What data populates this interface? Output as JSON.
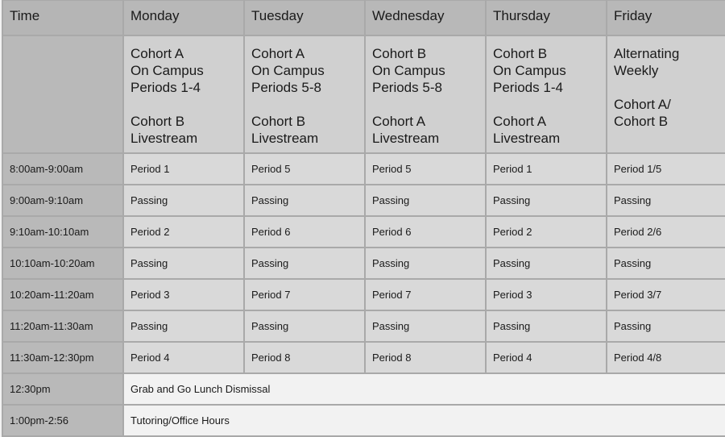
{
  "header": {
    "time_label": "Time",
    "days": [
      "Monday",
      "Tuesday",
      "Wednesday",
      "Thursday",
      "Friday"
    ]
  },
  "cohorts": [
    {
      "lines": [
        "Cohort A",
        "On Campus",
        "Periods 1-4"
      ],
      "lines2": [
        "Cohort B",
        "Livestream"
      ]
    },
    {
      "lines": [
        "Cohort A",
        "On Campus",
        "Periods 5-8"
      ],
      "lines2": [
        "Cohort B",
        "Livestream"
      ]
    },
    {
      "lines": [
        "Cohort B",
        "On Campus",
        "Periods 5-8"
      ],
      "lines2": [
        "Cohort A",
        "Livestream"
      ]
    },
    {
      "lines": [
        "Cohort B",
        "On Campus",
        "Periods 1-4"
      ],
      "lines2": [
        "Cohort A",
        "Livestream"
      ]
    },
    {
      "lines": [
        "Alternating",
        "Weekly"
      ],
      "lines2": [
        "Cohort A/",
        "Cohort B"
      ]
    }
  ],
  "rows": [
    {
      "time": "8:00am-9:00am",
      "cells": [
        "Period 1",
        "Period 5",
        "Period 5",
        "Period 1",
        "Period 1/5"
      ]
    },
    {
      "time": "9:00am-9:10am",
      "cells": [
        "Passing",
        "Passing",
        "Passing",
        "Passing",
        "Passing"
      ]
    },
    {
      "time": "9:10am-10:10am",
      "cells": [
        "Period 2",
        "Period 6",
        "Period 6",
        "Period 2",
        "Period 2/6"
      ]
    },
    {
      "time": "10:10am-10:20am",
      "cells": [
        "Passing",
        "Passing",
        "Passing",
        "Passing",
        "Passing"
      ]
    },
    {
      "time": "10:20am-11:20am",
      "cells": [
        "Period 3",
        "Period 7",
        "Period 7",
        "Period 3",
        "Period 3/7"
      ]
    },
    {
      "time": "11:20am-11:30am",
      "cells": [
        "Passing",
        "Passing",
        "Passing",
        "Passing",
        "Passing"
      ]
    },
    {
      "time": "11:30am-12:30pm",
      "cells": [
        "Period 4",
        "Period 8",
        "Period 8",
        "Period 4",
        "Period 4/8"
      ]
    }
  ],
  "span_rows": [
    {
      "time": "12:30pm",
      "text": "Grab and Go Lunch Dismissal"
    },
    {
      "time": "1:00pm-2:56",
      "text": "Tutoring/Office Hours"
    }
  ]
}
